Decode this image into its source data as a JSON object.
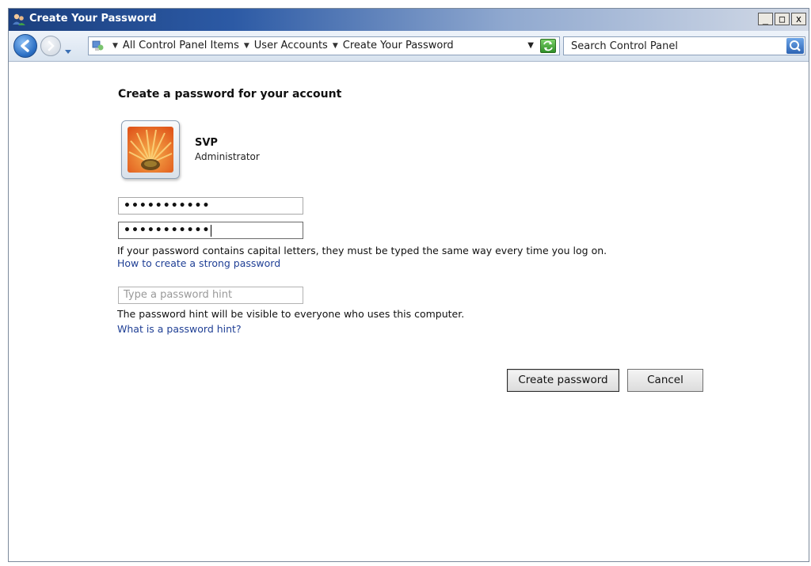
{
  "window": {
    "title": "Create Your Password",
    "controls": {
      "minimize": "_",
      "maximize": "□",
      "close": "x"
    }
  },
  "navbar": {
    "breadcrumbs": [
      "All Control Panel Items",
      "User Accounts",
      "Create Your Password"
    ],
    "search": {
      "placeholder": "Search Control Panel"
    },
    "icons": {
      "back": "back-arrow-icon",
      "forward": "forward-arrow-icon",
      "address": "control-panel-icon",
      "refresh": "refresh-icon",
      "search": "search-icon"
    }
  },
  "main": {
    "heading": "Create a password for your account",
    "user": {
      "name": "SVP",
      "role": "Administrator"
    },
    "password_field": {
      "value": "•••••••••••"
    },
    "confirm_field": {
      "value": "•••••••••••"
    },
    "caps_note": "If your password contains capital letters, they must be typed the same way every time you log on.",
    "strong_link": "How to create a strong password",
    "hint_field": {
      "placeholder": "Type a password hint",
      "value": ""
    },
    "hint_note": "The password hint will be visible to everyone who uses this computer.",
    "hint_link": "What is a password hint?",
    "buttons": {
      "create": "Create password",
      "cancel": "Cancel"
    }
  },
  "colors": {
    "title_bar": "#1b3f7e",
    "link": "#1f3f95",
    "address_border": "#8ba0bb"
  }
}
